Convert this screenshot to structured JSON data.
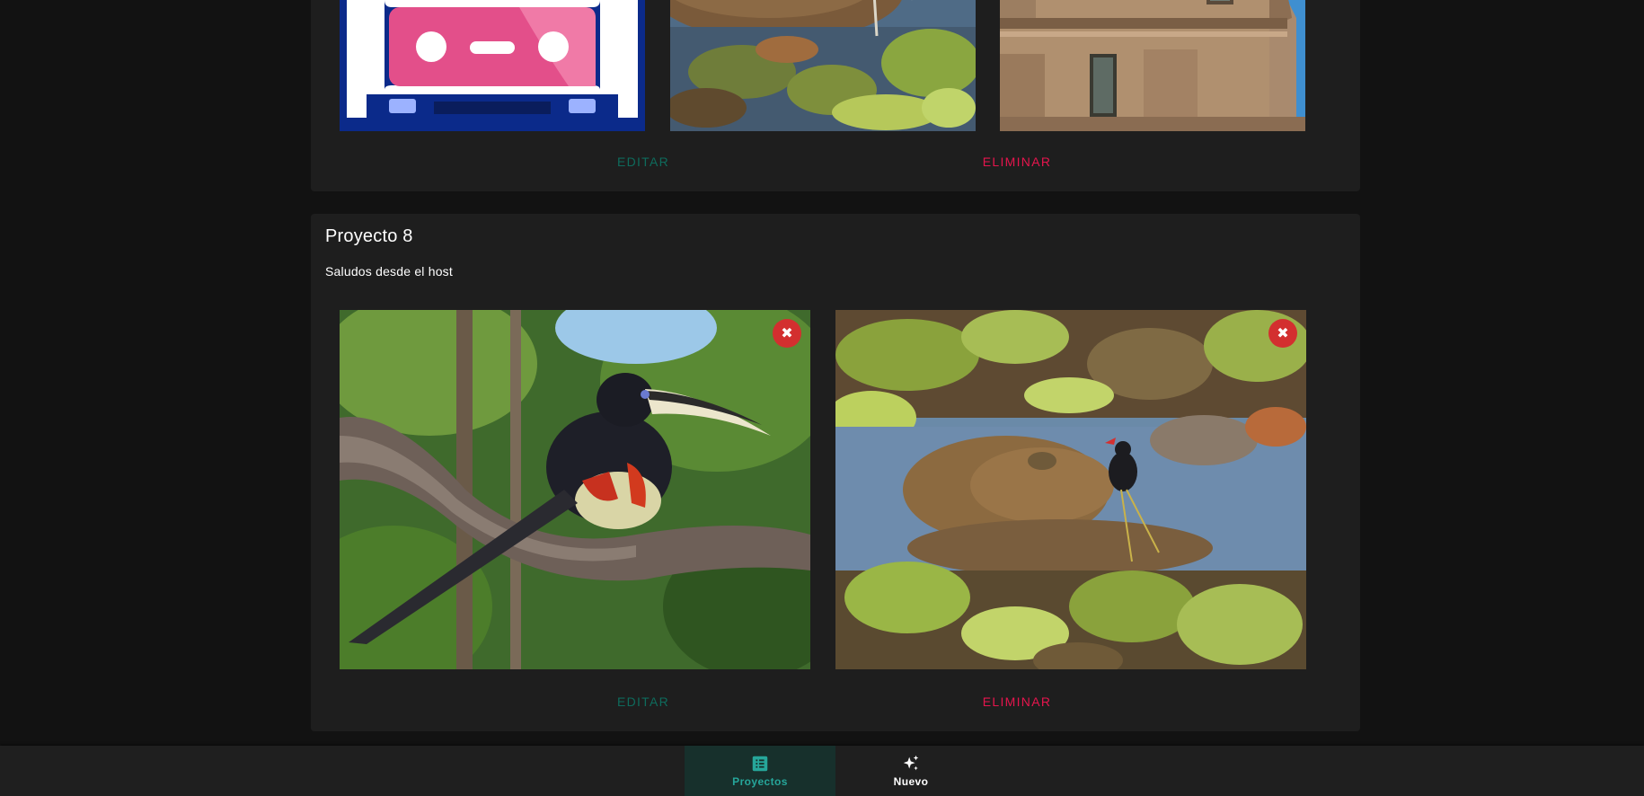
{
  "projects": [
    {
      "title": "",
      "description": "",
      "edit_label": "EDITAR",
      "delete_label": "ELIMINAR",
      "images": [
        "cassette-illustration",
        "capybara-photo",
        "building-facade-photo"
      ]
    },
    {
      "title": "Proyecto 8",
      "description": "Saludos desde el host",
      "edit_label": "EDITAR",
      "delete_label": "ELIMINAR",
      "remove_symbol": "✖",
      "images": [
        "aracari-bird-photo",
        "capybara-photo"
      ]
    }
  ],
  "bottom_nav": {
    "items": [
      {
        "label": "Proyectos",
        "icon": "list-box-icon",
        "active": true
      },
      {
        "label": "Nuevo",
        "icon": "sparkles-icon",
        "active": false
      }
    ]
  },
  "colors": {
    "background": "#121212",
    "card": "#1e1e1e",
    "accent": "#26a69a",
    "edit": "#0e6b5c",
    "delete": "#e5154d",
    "remove_button": "#d32f2f"
  }
}
